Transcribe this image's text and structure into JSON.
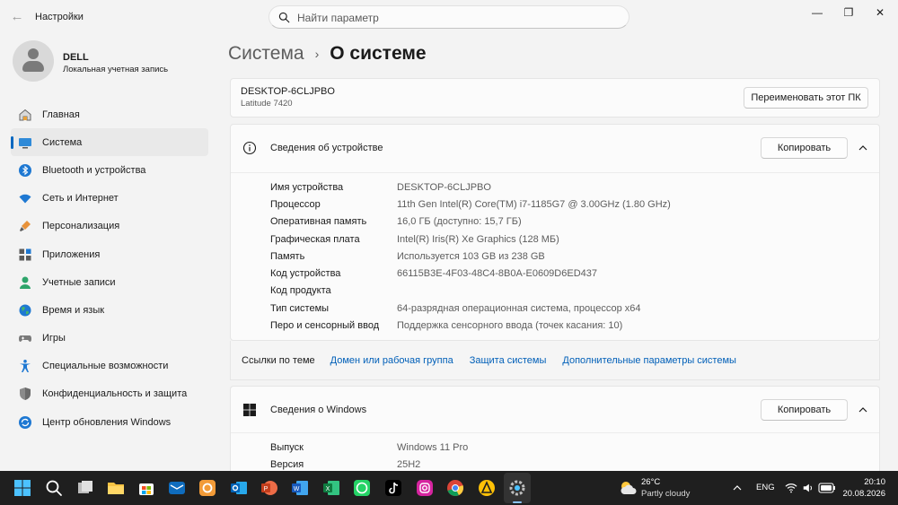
{
  "window": {
    "title": "Настройки",
    "controls": {
      "minimize": "—",
      "maximize": "❐",
      "close": "✕"
    }
  },
  "search": {
    "placeholder": "Найти параметр",
    "value": ""
  },
  "profile": {
    "name": "DELL",
    "account_type": "Локальная учетная запись"
  },
  "sidebar": {
    "items": [
      {
        "label": "Главная",
        "icon": "home-icon"
      },
      {
        "label": "Система",
        "icon": "system-icon",
        "active": true
      },
      {
        "label": "Bluetooth и устройства",
        "icon": "bluetooth-icon"
      },
      {
        "label": "Сеть и Интернет",
        "icon": "wifi-icon"
      },
      {
        "label": "Персонализация",
        "icon": "brush-icon"
      },
      {
        "label": "Приложения",
        "icon": "apps-icon"
      },
      {
        "label": "Учетные записи",
        "icon": "accounts-icon"
      },
      {
        "label": "Время и язык",
        "icon": "globe-icon"
      },
      {
        "label": "Игры",
        "icon": "gamepad-icon"
      },
      {
        "label": "Специальные возможности",
        "icon": "accessibility-icon"
      },
      {
        "label": "Конфиденциальность и защита",
        "icon": "shield-icon"
      },
      {
        "label": "Центр обновления Windows",
        "icon": "update-icon"
      }
    ]
  },
  "breadcrumb": {
    "parent": "Система",
    "separator": "›",
    "current": "О системе"
  },
  "pc": {
    "name": "DESKTOP-6CLJPBO",
    "model": "Latitude 7420",
    "rename_label": "Переименовать этот ПК"
  },
  "device_specs": {
    "title": "Сведения об устройстве",
    "copy_label": "Копировать",
    "rows": [
      {
        "label": "Имя устройства",
        "value": "DESKTOP-6CLJPBO"
      },
      {
        "label": "Процессор",
        "value": "11th Gen Intel(R) Core(TM) i7-1185G7 @ 3.00GHz (1.80 GHz)"
      },
      {
        "label": "Оперативная память",
        "value": "16,0 ГБ (доступно: 15,7 ГБ)"
      },
      {
        "label": "Графическая плата",
        "value": "Intel(R) Iris(R) Xe Graphics (128 МБ)"
      },
      {
        "label": "Память",
        "value": "Используется 103 GB из 238 GB"
      },
      {
        "label": "Код устройства",
        "value": "66115B3E-4F03-48C4-8B0A-E0609D6ED437"
      },
      {
        "label": "Код продукта",
        "value": ""
      },
      {
        "label": "Тип системы",
        "value": "64-разрядная операционная система, процессор x64"
      },
      {
        "label": "Перо и сенсорный ввод",
        "value": "Поддержка сенсорного ввода (точек касания: 10)"
      }
    ]
  },
  "related_links": {
    "title": "Ссылки по теме",
    "links": [
      "Домен или рабочая группа",
      "Защита системы",
      "Дополнительные параметры системы"
    ]
  },
  "windows_specs": {
    "title": "Сведения о Windows",
    "copy_label": "Копировать",
    "rows": [
      {
        "label": "Выпуск",
        "value": "Windows 11 Pro"
      },
      {
        "label": "Версия",
        "value": "25H2"
      }
    ]
  },
  "taskbar": {
    "weather": {
      "temp": "26°C",
      "desc": "Partly cloudy"
    },
    "language": "ENG",
    "time": "20:10",
    "date": "20.08.2026",
    "colors": {
      "accent": "#0067c0",
      "link": "#005fb8",
      "taskbar_bg": "#1f1f1f"
    }
  }
}
